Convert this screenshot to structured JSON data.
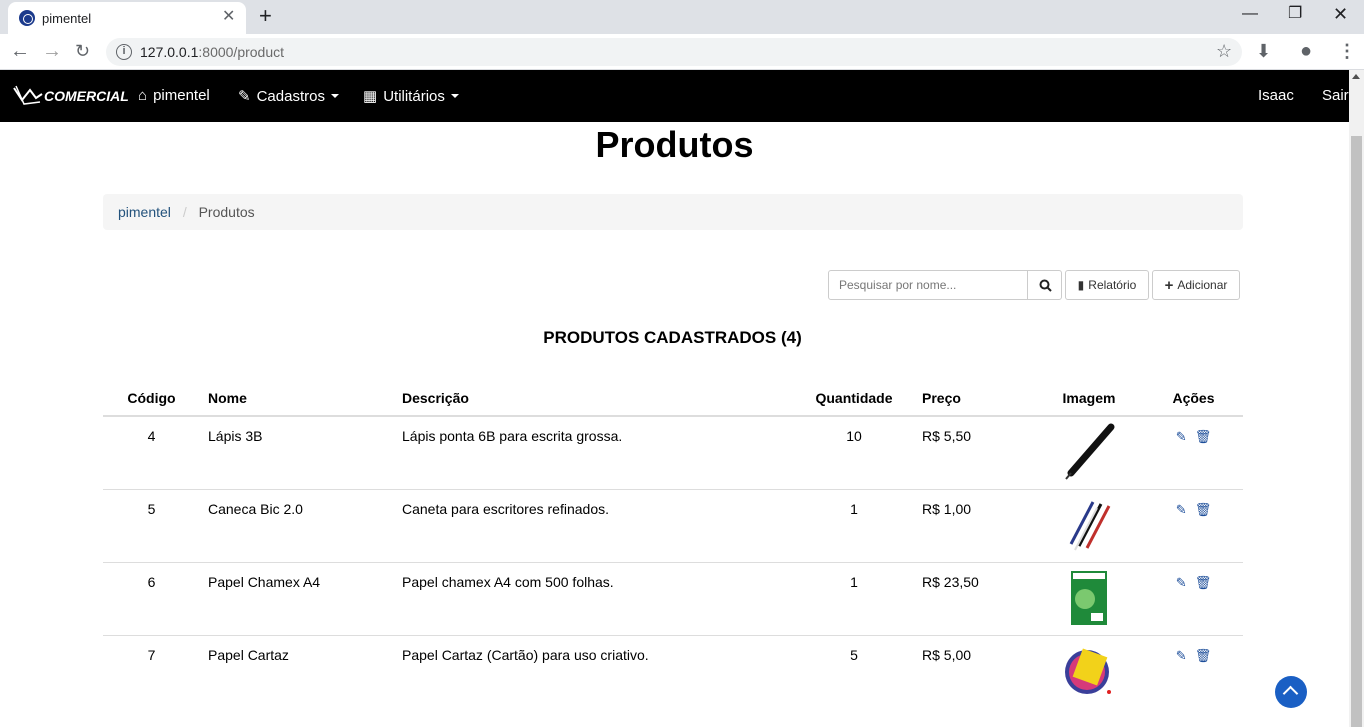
{
  "browser": {
    "tab_title": "pimentel",
    "url_host": "127.0.0.1",
    "url_path": ":8000/product"
  },
  "navbar": {
    "brand": "COMERCIAL",
    "home": "pimentel",
    "cadastros": "Cadastros",
    "utilitarios": "Utilitários",
    "user": "Isaac",
    "logout": "Sair"
  },
  "page": {
    "title": "Produtos",
    "breadcrumb": {
      "root": "pimentel",
      "current": "Produtos"
    },
    "search": {
      "placeholder": "Pesquisar por nome..."
    },
    "buttons": {
      "report": "Relatório",
      "add": "Adicionar"
    },
    "table_title": "PRODUTOS CADASTRADOS (4)"
  },
  "table": {
    "headers": {
      "code": "Código",
      "name": "Nome",
      "description": "Descrição",
      "quantity": "Quantidade",
      "price": "Preço",
      "image": "Imagem",
      "actions": "Ações"
    },
    "rows": [
      {
        "code": "4",
        "name": "Lápis 3B",
        "description": "Lápis ponta 6B para escrita grossa.",
        "quantity": "10",
        "price": "R$ 5,50",
        "image": "pencil-image"
      },
      {
        "code": "5",
        "name": "Caneca Bic 2.0",
        "description": "Caneta para escritores refinados.",
        "quantity": "1",
        "price": "R$ 1,00",
        "image": "pens-image"
      },
      {
        "code": "6",
        "name": "Papel Chamex A4",
        "description": "Papel chamex A4 com 500 folhas.",
        "quantity": "1",
        "price": "R$ 23,50",
        "image": "paper-ream-image"
      },
      {
        "code": "7",
        "name": "Papel Cartaz",
        "description": "Papel Cartaz (Cartão) para uso criativo.",
        "quantity": "5",
        "price": "R$ 5,00",
        "image": "colored-paper-image"
      }
    ]
  },
  "colors": {
    "navbar_bg": "#000000",
    "link": "#23527c",
    "action_icon": "#1d4e9a",
    "to_top": "#1a5fc4"
  }
}
